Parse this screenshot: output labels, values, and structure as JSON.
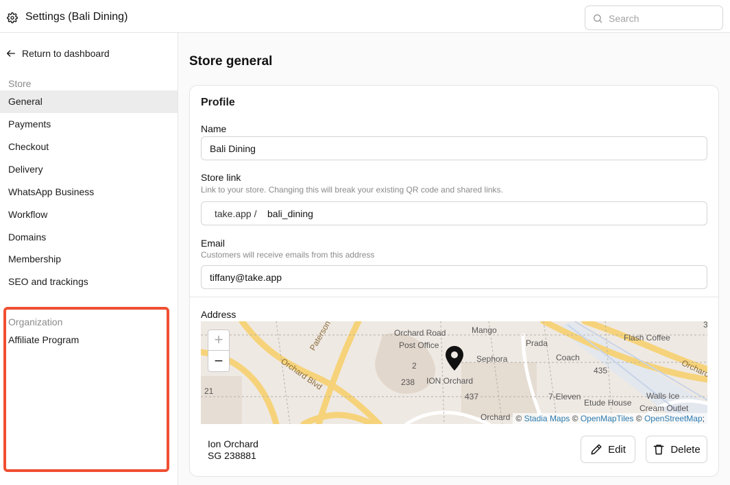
{
  "header": {
    "title": "Settings (Bali Dining)",
    "search_placeholder": "Search"
  },
  "sidebar": {
    "back_label": "Return to dashboard",
    "store_group_label": "Store",
    "store_items": [
      {
        "label": "General"
      },
      {
        "label": "Payments"
      },
      {
        "label": "Checkout"
      },
      {
        "label": "Delivery"
      },
      {
        "label": "WhatsApp Business"
      },
      {
        "label": "Workflow"
      },
      {
        "label": "Domains"
      },
      {
        "label": "Membership"
      },
      {
        "label": "SEO and trackings"
      }
    ],
    "organization_group_label": "Organization",
    "organization_items": [
      {
        "label": "Affiliate Program"
      }
    ]
  },
  "main": {
    "page_title": "Store general",
    "profile": {
      "title": "Profile",
      "name_label": "Name",
      "name_value": "Bali Dining",
      "store_link_label": "Store link",
      "store_link_help": "Link to your store. Changing this will break your existing QR code and shared links.",
      "store_link_prefix": "take.app /",
      "store_link_value": "bali_dining",
      "email_label": "Email",
      "email_help": "Customers will receive emails from this address",
      "email_value": "tiffany@take.app",
      "address_label": "Address",
      "address_line1": "Ion Orchard",
      "address_line2": "SG 238881",
      "edit_label": "Edit",
      "delete_label": "Delete"
    },
    "map": {
      "zoom_in": "+",
      "zoom_out": "−",
      "labels": {
        "orchard_road_po_1": "Orchard Road",
        "orchard_road_po_2": "Post Office",
        "mango": "Mango",
        "prada": "Prada",
        "flash_coffee": "Flash Coffee",
        "sephora": "Sephora",
        "coach": "Coach",
        "ion_orchard": "ION Orchard",
        "orchard_blvd": "Orchard Blvd",
        "paterson": "Paterson",
        "n435": "435",
        "n437": "437",
        "n238": "238",
        "n2": "2",
        "n21": "21",
        "seven_eleven": "7-Eleven",
        "etude_house": "Etude House",
        "walls_ice_1": "Walls Ice",
        "walls_ice_2": "Cream Outlet",
        "orchard_road_right": "Orchard",
        "n3": "3",
        "orchard_bottom": "Orchard"
      },
      "attribution": {
        "c1": "©",
        "stadia": "Stadia Maps",
        "c2": "©",
        "openmaptiles": "OpenMapTiles",
        "c3": "©",
        "osm": "OpenStreetMap",
        "end": ";"
      }
    }
  }
}
